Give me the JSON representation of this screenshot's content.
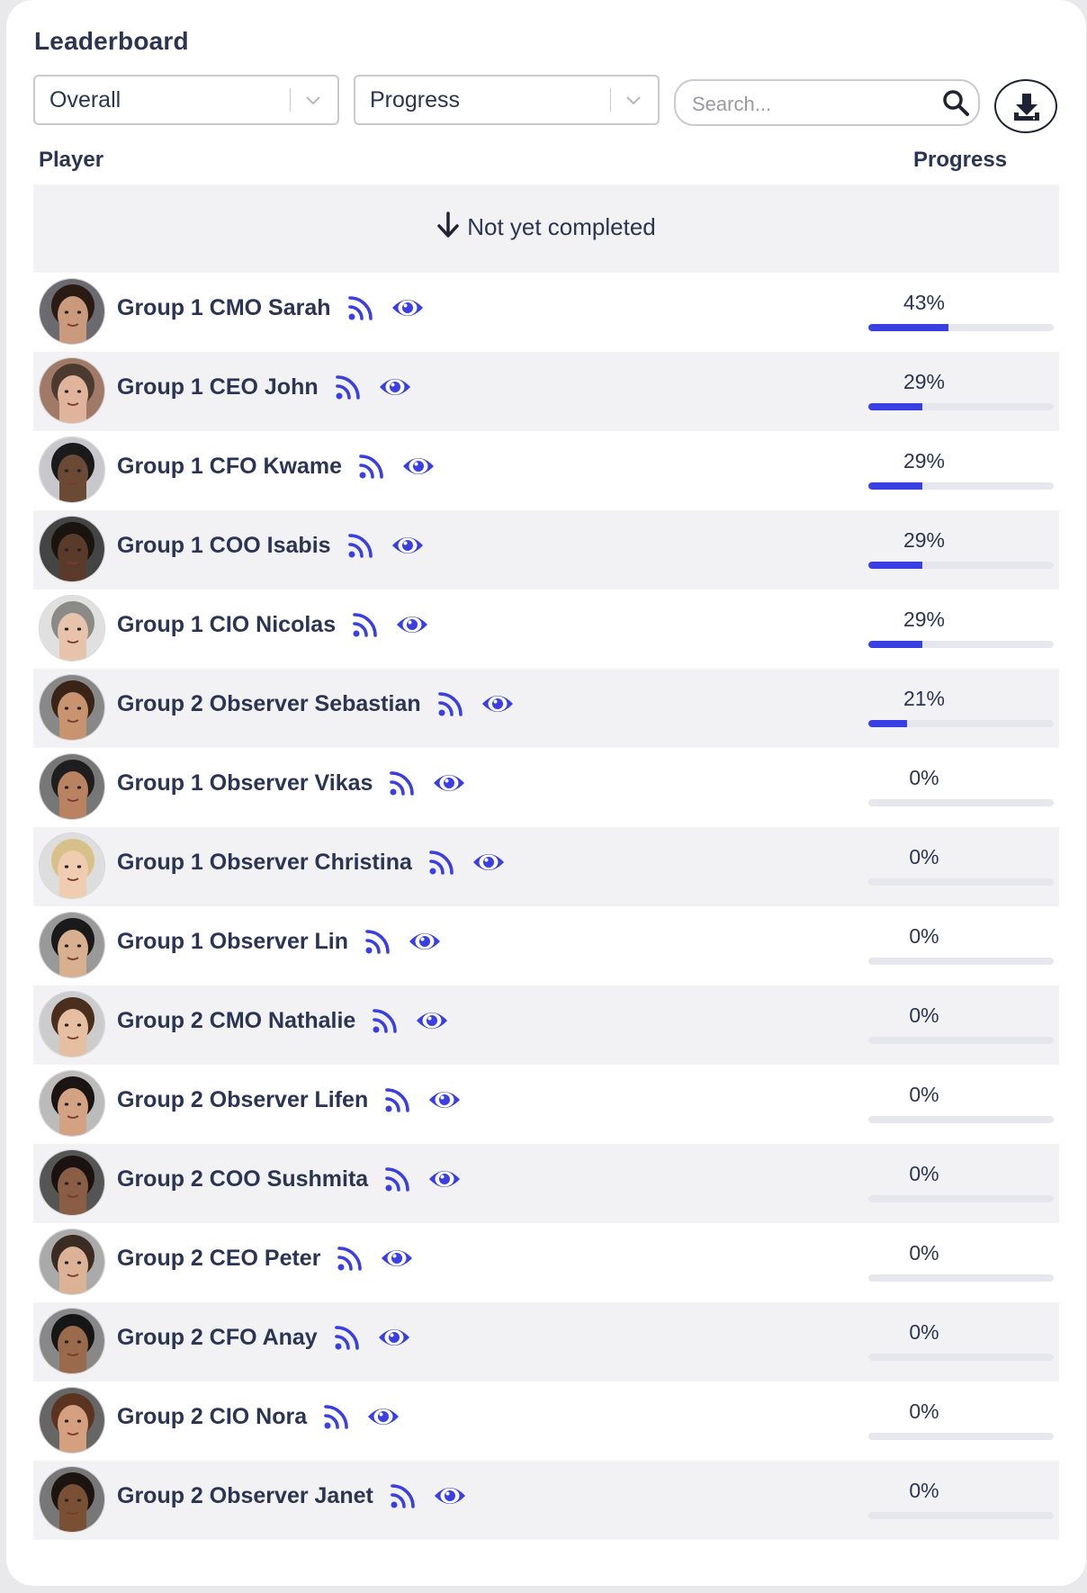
{
  "title": "Leaderboard",
  "filters": {
    "scope_value": "Overall",
    "sort_value": "Progress",
    "search_placeholder": "Search..."
  },
  "columns": {
    "player": "Player",
    "progress": "Progress"
  },
  "group_heading": "Not yet completed",
  "colors": {
    "accent": "#3a3fe3",
    "text": "#2b3553",
    "stripe": "#f2f2f4",
    "track": "#e6e7ec"
  },
  "icons": {
    "feed": "rss-icon",
    "view": "eye-icon",
    "search": "search-icon",
    "download": "download-icon",
    "sort": "arrow-down-icon"
  },
  "players": [
    {
      "name": "Group 1 CMO Sarah",
      "progress_label": "43%",
      "progress": 0.43
    },
    {
      "name": "Group 1 CEO John",
      "progress_label": "29%",
      "progress": 0.29
    },
    {
      "name": "Group 1 CFO Kwame",
      "progress_label": "29%",
      "progress": 0.29
    },
    {
      "name": "Group 1 COO Isabis",
      "progress_label": "29%",
      "progress": 0.29
    },
    {
      "name": "Group 1 CIO Nicolas",
      "progress_label": "29%",
      "progress": 0.29
    },
    {
      "name": "Group 2 Observer Sebastian",
      "progress_label": "21%",
      "progress": 0.21
    },
    {
      "name": "Group 1 Observer Vikas",
      "progress_label": "0%",
      "progress": 0
    },
    {
      "name": "Group 1 Observer Christina",
      "progress_label": "0%",
      "progress": 0
    },
    {
      "name": "Group 1 Observer Lin",
      "progress_label": "0%",
      "progress": 0
    },
    {
      "name": "Group 2 CMO Nathalie",
      "progress_label": "0%",
      "progress": 0
    },
    {
      "name": "Group 2 Observer Lifen",
      "progress_label": "0%",
      "progress": 0
    },
    {
      "name": "Group 2 COO Sushmita",
      "progress_label": "0%",
      "progress": 0
    },
    {
      "name": "Group 2 CEO Peter",
      "progress_label": "0%",
      "progress": 0
    },
    {
      "name": "Group 2 CFO Anay",
      "progress_label": "0%",
      "progress": 0
    },
    {
      "name": "Group 2 CIO Nora",
      "progress_label": "0%",
      "progress": 0
    },
    {
      "name": "Group 2 Observer Janet",
      "progress_label": "0%",
      "progress": 0
    }
  ]
}
